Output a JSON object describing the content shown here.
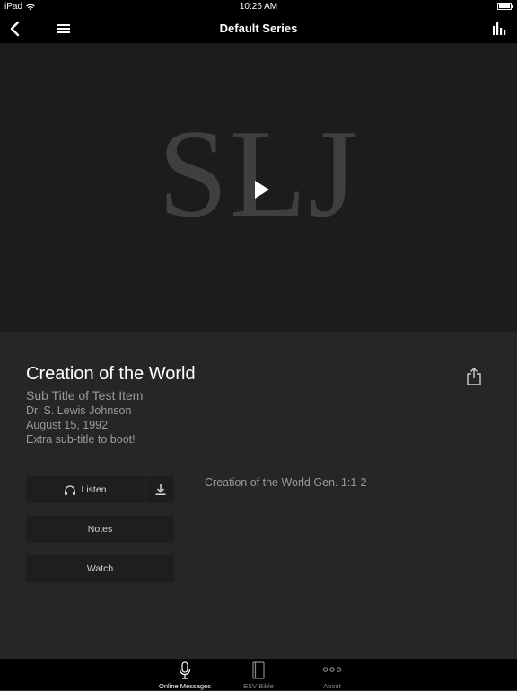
{
  "status_bar": {
    "carrier": "iPad",
    "time": "10:26 AM"
  },
  "nav": {
    "title": "Default Series"
  },
  "hero": {
    "logo_text": "SLJ"
  },
  "item": {
    "title": "Creation of the World",
    "subtitle": "Sub Title of Test Item",
    "author": "Dr. S. Lewis Johnson",
    "date": "August 15, 1992",
    "extra": "Extra sub-title to boot!",
    "description": "Creation of the World Gen. 1:1-2"
  },
  "actions": {
    "listen": "Listen",
    "notes": "Notes",
    "watch": "Watch"
  },
  "tabs": [
    {
      "label": "Online Messages",
      "icon": "microphone-icon",
      "active": true
    },
    {
      "label": "ESV Bible",
      "icon": "book-icon",
      "active": false
    },
    {
      "label": "About",
      "icon": "more-dots-icon",
      "active": false
    }
  ],
  "colors": {
    "background": "#262626",
    "hero": "#1c1c1c",
    "bar": "#000000",
    "muted_text": "#9a9a9a"
  }
}
